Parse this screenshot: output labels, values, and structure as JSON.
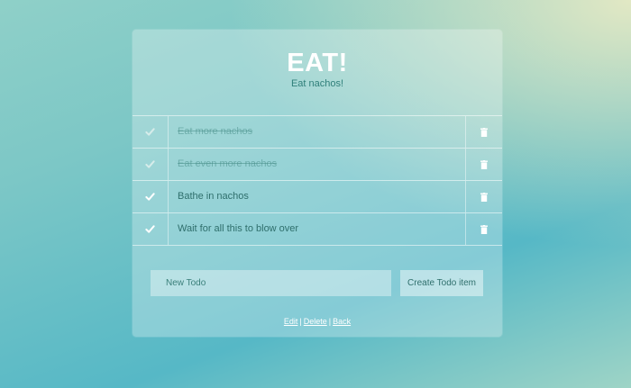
{
  "header": {
    "title": "EAT!",
    "subtitle": "Eat nachos!"
  },
  "todos": [
    {
      "text": "Eat more nachos",
      "done": true
    },
    {
      "text": "Eat even more nachos",
      "done": true
    },
    {
      "text": "Bathe in nachos",
      "done": false
    },
    {
      "text": "Wait for all this to blow over",
      "done": false
    }
  ],
  "form": {
    "new_todo_placeholder": "New Todo",
    "create_label": "Create Todo item"
  },
  "footer": {
    "edit_label": "Edit",
    "delete_label": "Delete",
    "back_label": "Back",
    "separator": "|"
  },
  "icons": {
    "check": "check-icon",
    "trash": "trash-icon"
  },
  "colors": {
    "check_done": "#d6ecea",
    "check_pending": "#ffffff",
    "text": "#2f6f6c"
  }
}
